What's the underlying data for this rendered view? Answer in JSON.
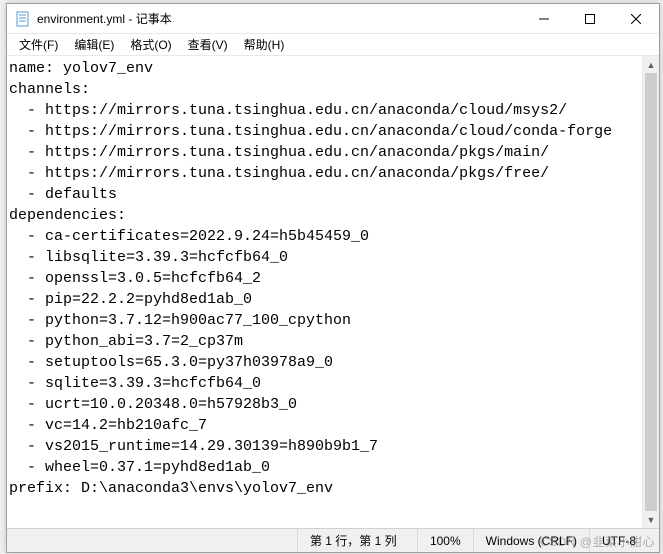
{
  "titlebar": {
    "icon": "notepad-icon",
    "title": "environment.yml - 记事本"
  },
  "menubar": {
    "items": [
      "文件(F)",
      "编辑(E)",
      "格式(O)",
      "查看(V)",
      "帮助(H)"
    ]
  },
  "content": {
    "text": "name: yolov7_env\nchannels:\n  - https://mirrors.tuna.tsinghua.edu.cn/anaconda/cloud/msys2/\n  - https://mirrors.tuna.tsinghua.edu.cn/anaconda/cloud/conda-forge\n  - https://mirrors.tuna.tsinghua.edu.cn/anaconda/pkgs/main/\n  - https://mirrors.tuna.tsinghua.edu.cn/anaconda/pkgs/free/\n  - defaults\ndependencies:\n  - ca-certificates=2022.9.24=h5b45459_0\n  - libsqlite=3.39.3=hcfcfb64_0\n  - openssl=3.0.5=hcfcfb64_2\n  - pip=22.2.2=pyhd8ed1ab_0\n  - python=3.7.12=h900ac77_100_cpython\n  - python_abi=3.7=2_cp37m\n  - setuptools=65.3.0=py37h03978a9_0\n  - sqlite=3.39.3=hcfcfb64_0\n  - ucrt=10.0.20348.0=h57928b3_0\n  - vc=14.2=hb210afc_7\n  - vs2015_runtime=14.29.30139=h890b9b1_7\n  - wheel=0.37.1=pyhd8ed1ab_0\nprefix: D:\\anaconda3\\envs\\yolov7_env"
  },
  "statusbar": {
    "position": "第 1 行，第 1 列",
    "zoom": "100%",
    "eol": "Windows (CRLF)",
    "encoding": "UTF-8"
  },
  "watermark": "CSDN @韭菜小甜心"
}
